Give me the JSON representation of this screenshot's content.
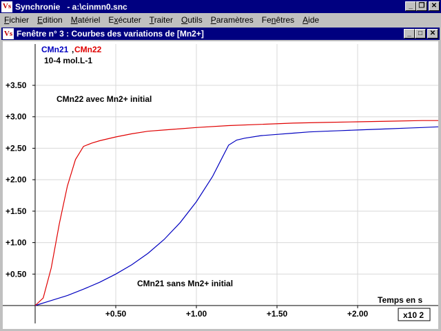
{
  "app": {
    "title": "Synchronie   - a:\\cinmn0.snc",
    "icon_text": "Vs",
    "controls": [
      "minimize-icon",
      "restore-icon",
      "close-icon"
    ]
  },
  "menu": [
    {
      "key": "fichier",
      "label": "Fichier",
      "acc": "F"
    },
    {
      "key": "edition",
      "label": "Edition",
      "acc": "E"
    },
    {
      "key": "materiel",
      "label": "Matériel",
      "acc": "M"
    },
    {
      "key": "executer",
      "label": "Exécuter",
      "acc": "x"
    },
    {
      "key": "traiter",
      "label": "Traiter",
      "acc": "T"
    },
    {
      "key": "outils",
      "label": "Outils",
      "acc": "O"
    },
    {
      "key": "parametres",
      "label": "Paramètres",
      "acc": "P"
    },
    {
      "key": "fenetres",
      "label": "Fenêtres",
      "acc": "n"
    },
    {
      "key": "aide",
      "label": "Aide",
      "acc": "A"
    }
  ],
  "window": {
    "title": "Fenêtre n° 3 : Courbes des variations de [Mn2+]",
    "icon_text": "Vs"
  },
  "chart_data": {
    "type": "line",
    "xlabel": "Temps en s",
    "xunit": "x10 2",
    "ylabel_series": [
      "CMn21",
      "CMn22"
    ],
    "ylabel_sep": ",",
    "yunit": "10-4 mol.L-1",
    "xlim": [
      0,
      2.5
    ],
    "ylim": [
      0,
      4.2
    ],
    "xticks": [
      {
        "value": 0.5,
        "label": "+0.50"
      },
      {
        "value": 1.0,
        "label": "+1.00"
      },
      {
        "value": 1.5,
        "label": "+1.50"
      },
      {
        "value": 2.0,
        "label": "+2.00"
      }
    ],
    "yticks": [
      {
        "value": 0.5,
        "label": "+0.50"
      },
      {
        "value": 1.0,
        "label": "+1.00"
      },
      {
        "value": 1.5,
        "label": "+1.50"
      },
      {
        "value": 2.0,
        "label": "+2.00"
      },
      {
        "value": 2.5,
        "label": "+2.50"
      },
      {
        "value": 3.0,
        "label": "+3.00"
      },
      {
        "value": 3.5,
        "label": "+3.50"
      }
    ],
    "annotations": [
      {
        "text": "CMn22 avec Mn2+ initial"
      },
      {
        "text": "CMn21 sans Mn2+ initial"
      }
    ],
    "series": [
      {
        "name": "CMn21",
        "color": "#0000c0",
        "x": [
          0,
          0.1,
          0.2,
          0.3,
          0.4,
          0.5,
          0.6,
          0.7,
          0.8,
          0.9,
          1.0,
          1.1,
          1.15,
          1.2,
          1.25,
          1.3,
          1.4,
          1.5,
          1.6,
          1.7,
          1.8,
          1.9,
          2.0,
          2.1,
          2.2,
          2.3,
          2.4,
          2.5
        ],
        "y": [
          0.0,
          0.08,
          0.16,
          0.26,
          0.37,
          0.5,
          0.65,
          0.83,
          1.05,
          1.32,
          1.65,
          2.05,
          2.3,
          2.55,
          2.63,
          2.66,
          2.7,
          2.72,
          2.74,
          2.76,
          2.77,
          2.78,
          2.79,
          2.8,
          2.81,
          2.82,
          2.83,
          2.84
        ]
      },
      {
        "name": "CMn22",
        "color": "#e00000",
        "x": [
          0,
          0.05,
          0.1,
          0.15,
          0.2,
          0.25,
          0.3,
          0.35,
          0.4,
          0.5,
          0.6,
          0.7,
          0.8,
          0.9,
          1.0,
          1.2,
          1.4,
          1.6,
          1.8,
          2.0,
          2.2,
          2.4,
          2.5
        ],
        "y": [
          0.0,
          0.12,
          0.6,
          1.3,
          1.9,
          2.32,
          2.53,
          2.58,
          2.62,
          2.68,
          2.73,
          2.77,
          2.79,
          2.81,
          2.83,
          2.86,
          2.88,
          2.9,
          2.91,
          2.92,
          2.93,
          2.94,
          2.94
        ]
      }
    ]
  }
}
